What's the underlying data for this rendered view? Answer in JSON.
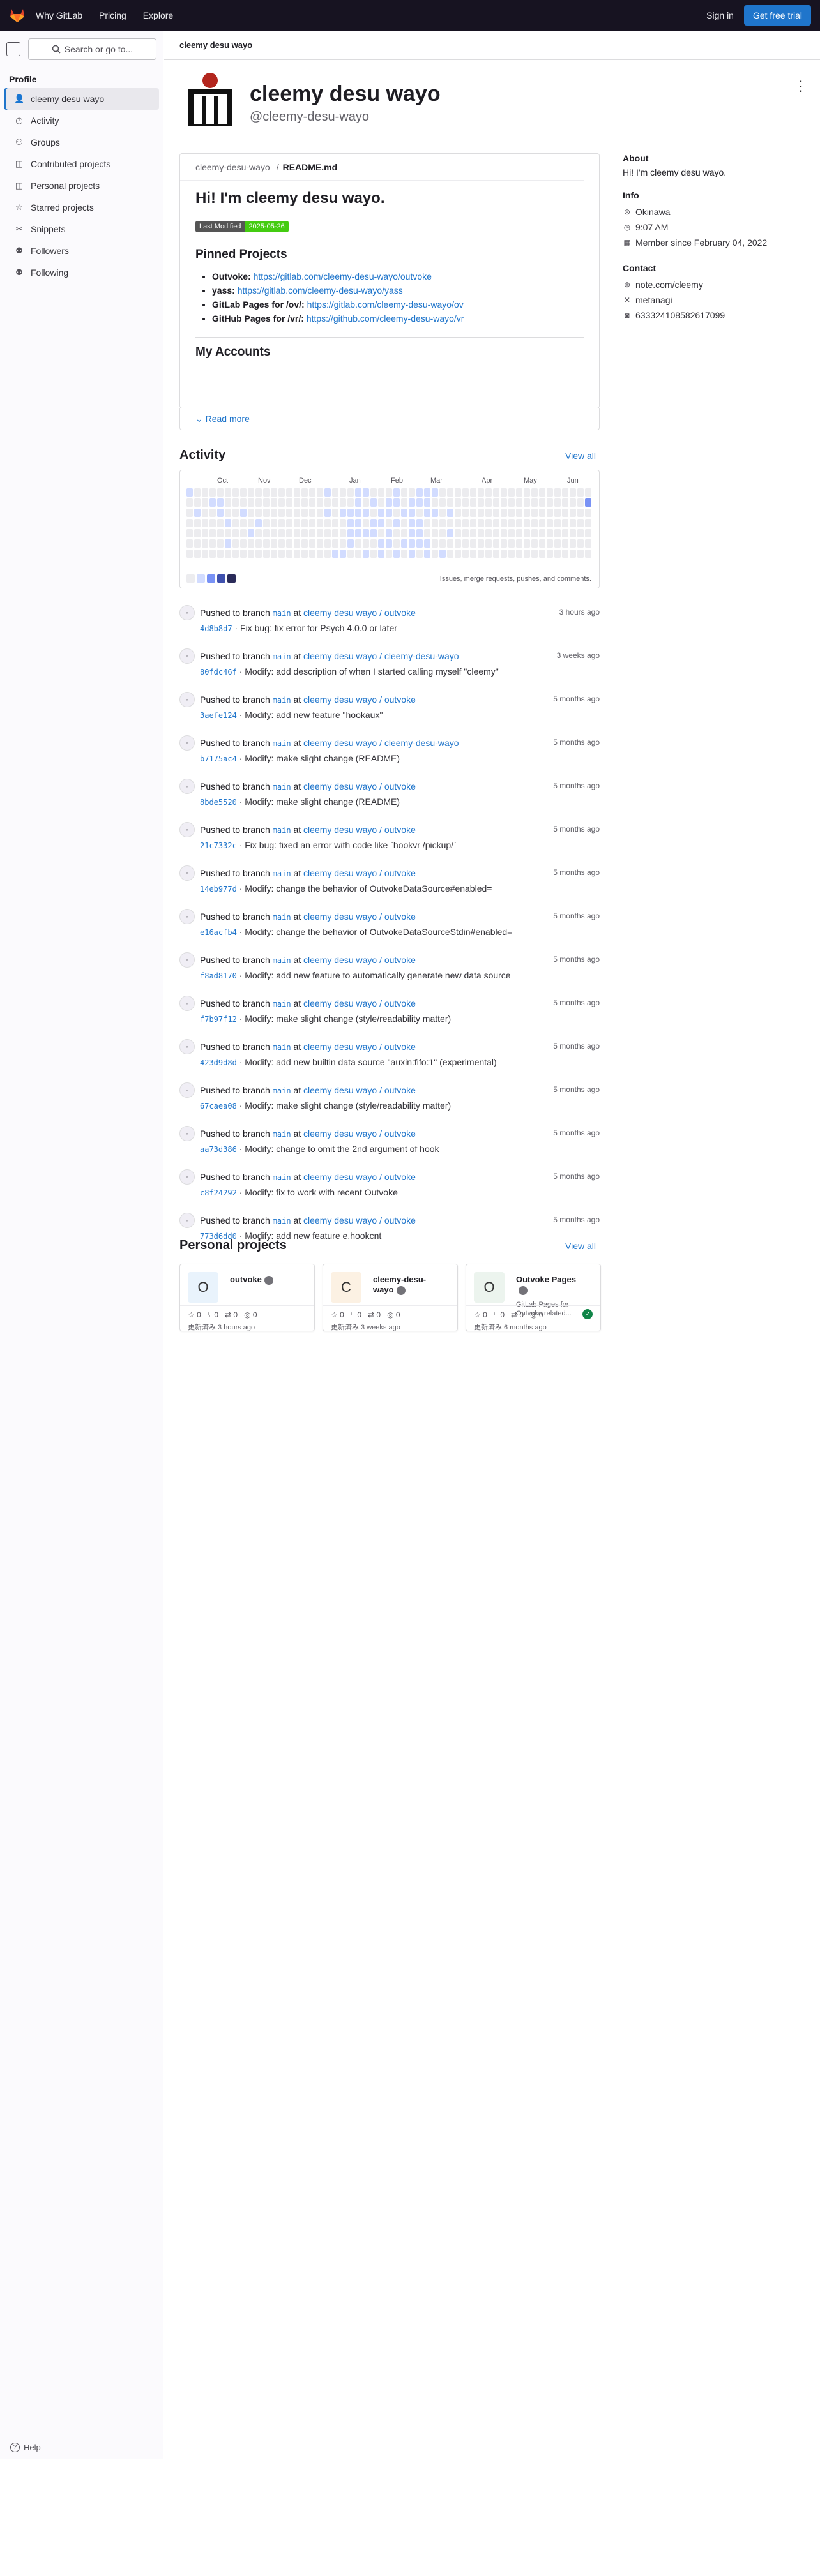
{
  "topbar": {
    "nav": [
      "Why GitLab",
      "Pricing",
      "Explore"
    ],
    "sign_in": "Sign in",
    "trial": "Get free trial",
    "colors": {
      "bg": "#171321",
      "accent": "#1f75cb"
    }
  },
  "sidebar": {
    "search": "Search or go to...",
    "section": "Profile",
    "items": [
      {
        "label": "cleemy desu wayo",
        "icon": "user-icon"
      },
      {
        "label": "Activity",
        "icon": "history-icon"
      },
      {
        "label": "Groups",
        "icon": "group-icon"
      },
      {
        "label": "Contributed projects",
        "icon": "project-icon"
      },
      {
        "label": "Personal projects",
        "icon": "project-icon"
      },
      {
        "label": "Starred projects",
        "icon": "star-icon"
      },
      {
        "label": "Snippets",
        "icon": "snippet-icon"
      },
      {
        "label": "Followers",
        "icon": "users-icon"
      },
      {
        "label": "Following",
        "icon": "users-icon"
      }
    ],
    "help": "Help"
  },
  "breadcrumb": "cleemy desu wayo",
  "profile": {
    "name": "cleemy desu wayo",
    "username": "@cleemy-desu-wayo"
  },
  "readme": {
    "owner": "cleemy-desu-wayo",
    "sep": "/",
    "file": "README.md",
    "title": "Hi! I'm cleemy desu wayo.",
    "badge_label": "Last Modified",
    "badge_value": "2025-05-26",
    "pinned_heading": "Pinned Projects",
    "pinned": [
      {
        "name": "Outvoke:",
        "url": "https://gitlab.com/cleemy-desu-wayo/outvoke"
      },
      {
        "name": "yass:",
        "url": "https://gitlab.com/cleemy-desu-wayo/yass"
      },
      {
        "name": "GitLab Pages for /ov/:",
        "url": "https://gitlab.com/cleemy-desu-wayo/ov"
      },
      {
        "name": "GitHub Pages for /vr/:",
        "url": "https://github.com/cleemy-desu-wayo/vr"
      }
    ],
    "accounts_heading": "My Accounts",
    "read_more": "Read more"
  },
  "about": {
    "heading": "About",
    "bio": "Hi! I'm cleemy desu wayo.",
    "info_heading": "Info",
    "location": "Okinawa",
    "local_time": "9:07 AM",
    "member_since": "Member since February 04, 2022",
    "contact_heading": "Contact",
    "website": "note.com/cleemy",
    "x": "metanagi",
    "discord": "633324108582617099"
  },
  "activity": {
    "heading": "Activity",
    "view_all": "View all",
    "months": [
      "Oct",
      "Nov",
      "Dec",
      "Jan",
      "Feb",
      "Mar",
      "Apr",
      "May",
      "Jun"
    ],
    "footer": "Issues, merge requests, pushes, and comments.",
    "level_colors": [
      "#ececef",
      "#d2dcff",
      "#7992f5",
      "#3f51ae",
      "#2a2b59"
    ],
    "events": [
      {
        "action": "Pushed to branch",
        "branch": "main",
        "at": "at",
        "project": "cleemy desu wayo / outvoke",
        "sha": "4d8b8d7",
        "message": "· Fix bug: fix error for Psych 4.0.0 or later",
        "time": "3 hours ago"
      },
      {
        "action": "Pushed to branch",
        "branch": "main",
        "at": "at",
        "project": "cleemy desu wayo / cleemy-desu-wayo",
        "sha": "80fdc46f",
        "message": "· Modify: add description of when I started calling myself \"cleemy\"",
        "time": "3 weeks ago"
      },
      {
        "action": "Pushed to branch",
        "branch": "main",
        "at": "at",
        "project": "cleemy desu wayo / outvoke",
        "sha": "3aefe124",
        "message": "· Modify: add new feature \"hookaux\"",
        "time": "5 months ago"
      },
      {
        "action": "Pushed to branch",
        "branch": "main",
        "at": "at",
        "project": "cleemy desu wayo / cleemy-desu-wayo",
        "sha": "b7175ac4",
        "message": "· Modify: make slight change (README)",
        "time": "5 months ago"
      },
      {
        "action": "Pushed to branch",
        "branch": "main",
        "at": "at",
        "project": "cleemy desu wayo / outvoke",
        "sha": "8bde5520",
        "message": "· Modify: make slight change (README)",
        "time": "5 months ago"
      },
      {
        "action": "Pushed to branch",
        "branch": "main",
        "at": "at",
        "project": "cleemy desu wayo / outvoke",
        "sha": "21c7332c",
        "message": "· Fix bug: fixed an error with code like `hookvr /pickup/`",
        "time": "5 months ago"
      },
      {
        "action": "Pushed to branch",
        "branch": "main",
        "at": "at",
        "project": "cleemy desu wayo / outvoke",
        "sha": "14eb977d",
        "message": "· Modify: change the behavior of OutvokeDataSource#enabled=",
        "time": "5 months ago"
      },
      {
        "action": "Pushed to branch",
        "branch": "main",
        "at": "at",
        "project": "cleemy desu wayo / outvoke",
        "sha": "e16acfb4",
        "message": "· Modify: change the behavior of OutvokeDataSourceStdin#enabled=",
        "time": "5 months ago"
      },
      {
        "action": "Pushed to branch",
        "branch": "main",
        "at": "at",
        "project": "cleemy desu wayo / outvoke",
        "sha": "f8ad8170",
        "message": "· Modify: add new feature to automatically generate new data source",
        "time": "5 months ago"
      },
      {
        "action": "Pushed to branch",
        "branch": "main",
        "at": "at",
        "project": "cleemy desu wayo / outvoke",
        "sha": "f7b97f12",
        "message": "· Modify: make slight change (style/readability matter)",
        "time": "5 months ago"
      },
      {
        "action": "Pushed to branch",
        "branch": "main",
        "at": "at",
        "project": "cleemy desu wayo / outvoke",
        "sha": "423d9d8d",
        "message": "· Modify: add new builtin data source \"auxin:fifo:1\" (experimental)",
        "time": "5 months ago"
      },
      {
        "action": "Pushed to branch",
        "branch": "main",
        "at": "at",
        "project": "cleemy desu wayo / outvoke",
        "sha": "67caea08",
        "message": "· Modify: make slight change (style/readability matter)",
        "time": "5 months ago"
      },
      {
        "action": "Pushed to branch",
        "branch": "main",
        "at": "at",
        "project": "cleemy desu wayo / outvoke",
        "sha": "aa73d386",
        "message": "· Modify: change to omit the 2nd argument of hook",
        "time": "5 months ago"
      },
      {
        "action": "Pushed to branch",
        "branch": "main",
        "at": "at",
        "project": "cleemy desu wayo / outvoke",
        "sha": "c8f24292",
        "message": "· Modify: fix to work with recent Outvoke",
        "time": "5 months ago"
      },
      {
        "action": "Pushed to branch",
        "branch": "main",
        "at": "at",
        "project": "cleemy desu wayo / outvoke",
        "sha": "773d6dd0",
        "message": "· Modify: add new feature e.hookcnt",
        "time": "5 months ago"
      }
    ]
  },
  "projects": {
    "heading": "Personal projects",
    "view_all": "View all",
    "cards": [
      {
        "initial": "O",
        "name": "outvoke",
        "desc": "",
        "stars": "0",
        "forks": "0",
        "mrs": "0",
        "issues": "0",
        "updated": "更新済み 3 hours ago",
        "color": "#e9f3fc",
        "pipeline": false
      },
      {
        "initial": "C",
        "name": "cleemy-desu-wayo",
        "desc": "",
        "stars": "0",
        "forks": "0",
        "mrs": "0",
        "issues": "0",
        "updated": "更新済み 3 weeks ago",
        "color": "#fcf1e3",
        "pipeline": false
      },
      {
        "initial": "O",
        "name": "Outvoke Pages",
        "desc": "GitLab Pages for Outvoke related...",
        "stars": "0",
        "forks": "0",
        "mrs": "0",
        "issues": "0",
        "updated": "更新済み 6 months ago",
        "color": "#ecf4ee",
        "pipeline": true
      }
    ]
  }
}
